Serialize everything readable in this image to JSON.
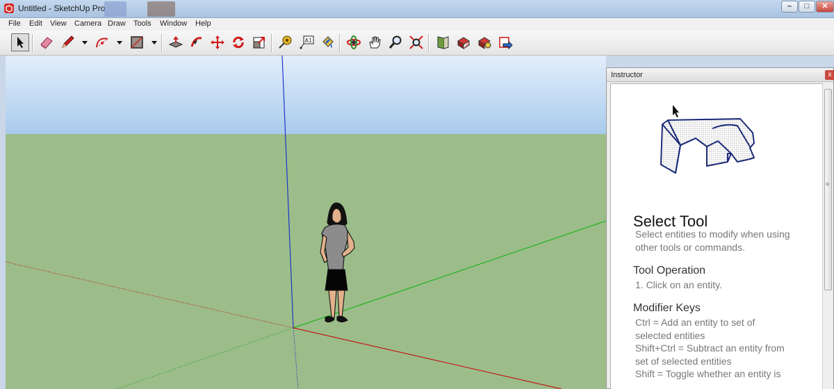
{
  "window": {
    "title": "Untitled - SketchUp Pro",
    "controls": {
      "minimize": "–",
      "maximize": "□",
      "close": "✕"
    }
  },
  "menu": [
    "File",
    "Edit",
    "View",
    "Camera",
    "Draw",
    "Tools",
    "Window",
    "Help"
  ],
  "toolbar": {
    "tools": [
      {
        "icon": "select-icon",
        "active": true
      },
      {
        "icon": "eraser-icon"
      },
      {
        "icon": "pencil-icon"
      },
      {
        "icon": "arc-icon"
      },
      {
        "icon": "rectangle-icon"
      },
      {
        "icon": "push-pull-icon"
      },
      {
        "icon": "follow-me-icon"
      },
      {
        "icon": "move-icon"
      },
      {
        "icon": "rotate-icon"
      },
      {
        "icon": "scale-icon"
      },
      {
        "icon": "tape-measure-icon"
      },
      {
        "icon": "text-icon"
      },
      {
        "icon": "paint-bucket-icon"
      },
      {
        "icon": "orbit-icon"
      },
      {
        "icon": "pan-icon"
      },
      {
        "icon": "zoom-icon"
      },
      {
        "icon": "zoom-extents-icon"
      },
      {
        "icon": "3d-warehouse-icon"
      },
      {
        "icon": "get-models-icon"
      },
      {
        "icon": "share-model-icon"
      },
      {
        "icon": "extension-warehouse-icon"
      }
    ],
    "text_tool_label": "A1"
  },
  "instructor": {
    "title": "Instructor",
    "close": "x",
    "heading": "Select Tool",
    "description": [
      "Select entities to modify when using",
      "other tools or commands."
    ],
    "operation_title": "Tool Operation",
    "operation_steps": [
      "1.  Click on an entity."
    ],
    "modifier_title": "Modifier Keys",
    "modifier_lines": [
      "Ctrl = Add an entity to set of",
      "selected entities",
      "Shift+Ctrl = Subtract an entity from",
      "set of selected entities",
      "Shift = Toggle whether an entity is"
    ]
  },
  "colors": {
    "sky_top": "#e3eefb",
    "sky_bottom": "#a9cbec",
    "ground": "#9cbd8a",
    "axis_blue": "#1e34c8",
    "axis_red": "#c21a1a",
    "axis_green": "#1fb41f"
  }
}
